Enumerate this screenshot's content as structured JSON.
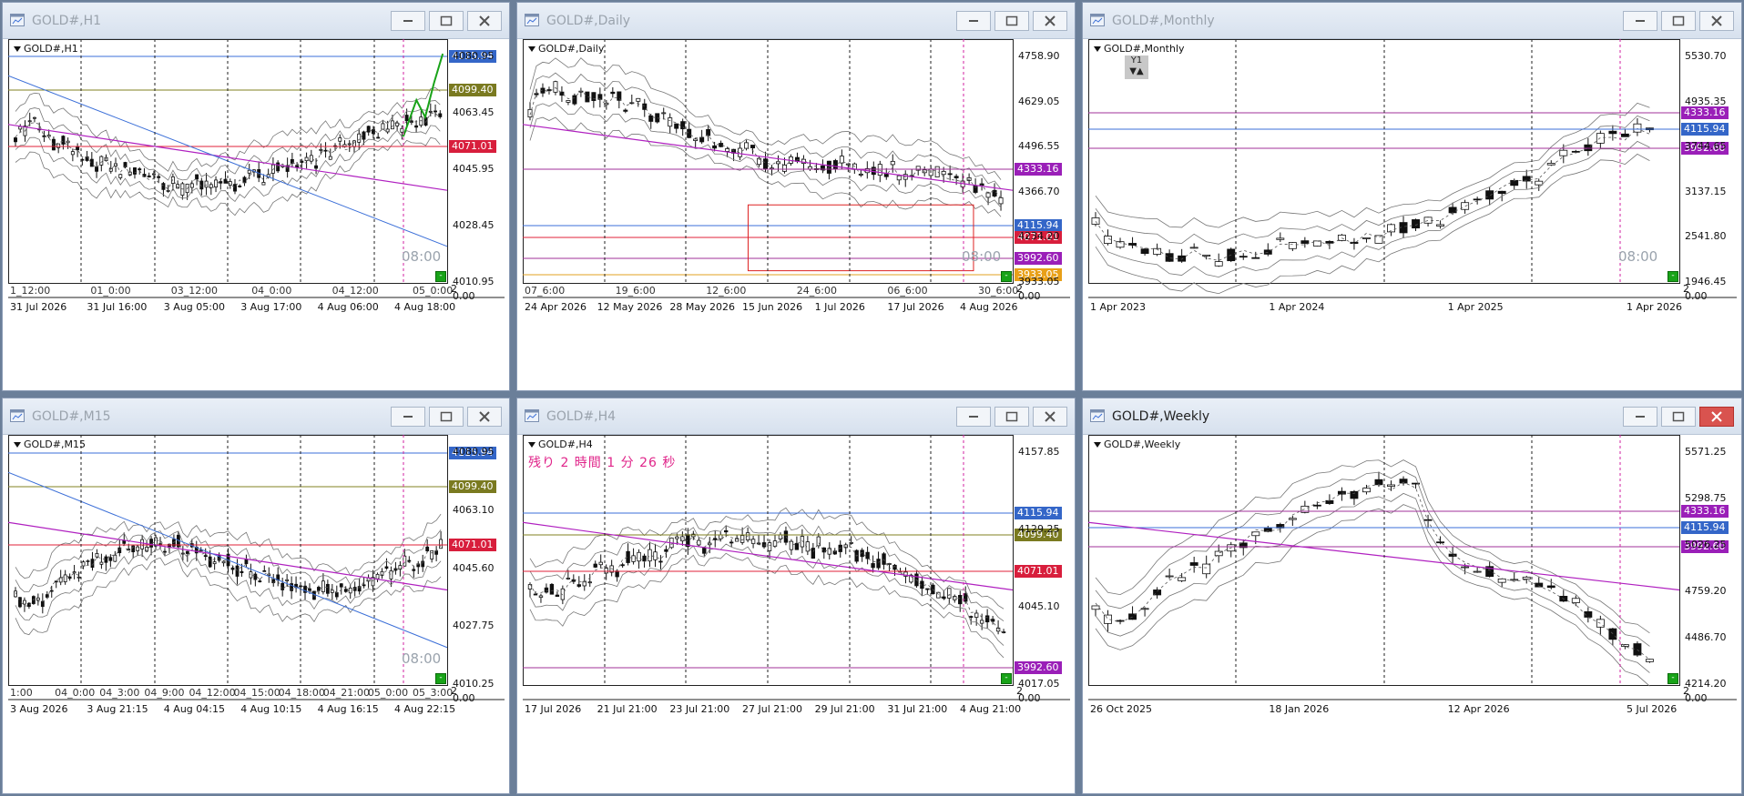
{
  "colors": {
    "blue_line": "#3b6fd8",
    "olive_line": "#808020",
    "red_line": "#e0203a",
    "purple_line": "#a0309a",
    "orange_line": "#e0a020",
    "magenta_trend": "#b020c0",
    "green_arrow": "#19a319",
    "lbl_blue": "#3466c8",
    "lbl_olive": "#7a7a20",
    "lbl_red": "#d81e3c",
    "lbl_purple": "#9a1fb8",
    "lbl_orange": "#e8a018"
  },
  "icons": {
    "window": "chart-window-icon",
    "minimize": "minimize-icon",
    "maximize": "maximize-icon",
    "close": "close-icon",
    "dropdown": "triangle-down-icon"
  },
  "windows": [
    {
      "id": "h1",
      "title": "GOLD#,H1",
      "symbol": "GOLD#,H1",
      "active": false,
      "price_ticks": [
        "4080.95",
        "4063.45",
        "4045.95",
        "4028.45",
        "4010.95"
      ],
      "price_labels": [
        {
          "text": "4115.94",
          "color": "lbl_blue"
        },
        {
          "text": "4099.40",
          "color": "lbl_olive"
        },
        {
          "text": "4071.01",
          "color": "lbl_red"
        }
      ],
      "time_top": [
        "1_12:00",
        "01_0:00",
        "03_12:00",
        "04_0:00",
        "04_12:00",
        "05_0:00"
      ],
      "time_bottom": [
        "31 Jul 2026",
        "31 Jul 16:00",
        "3 Aug 05:00",
        "3 Aug 17:00",
        "4 Aug 06:00",
        "4 Aug 18:00"
      ],
      "vline_label": "08:00",
      "corner_top": "2",
      "corner_bottom": "0.00"
    },
    {
      "id": "daily",
      "title": "GOLD#,Daily",
      "symbol": "GOLD#,Daily",
      "active": false,
      "price_ticks": [
        "4758.90",
        "4629.05",
        "4496.55",
        "4366.70",
        "4234.20",
        "3933.05"
      ],
      "price_labels": [
        {
          "text": "4333.16",
          "color": "lbl_purple"
        },
        {
          "text": "4115.94",
          "color": "lbl_blue"
        },
        {
          "text": "4071.01",
          "color": "lbl_red"
        },
        {
          "text": "3992.60",
          "color": "lbl_purple"
        },
        {
          "text": "3933.05",
          "color": "lbl_orange"
        }
      ],
      "time_top": [
        "07_6:00",
        "19_6:00",
        "12_6:00",
        "24_6:00",
        "06_6:00",
        "30_6:00"
      ],
      "time_bottom": [
        "24 Apr 2026",
        "12 May 2026",
        "28 May 2026",
        "15 Jun 2026",
        "1 Jul 2026",
        "17 Jul 2026",
        "4 Aug 2026"
      ],
      "vline_label": "08:00",
      "corner_top": "2",
      "corner_bottom": "0.00"
    },
    {
      "id": "monthly",
      "title": "GOLD#,Monthly",
      "symbol": "GOLD#,Monthly",
      "active": false,
      "price_ticks": [
        "5530.70",
        "4935.35",
        "3744.65",
        "3137.15",
        "2541.80",
        "1946.45"
      ],
      "price_labels": [
        {
          "text": "4333.16",
          "color": "lbl_purple"
        },
        {
          "text": "4115.94",
          "color": "lbl_blue"
        },
        {
          "text": "3992.60",
          "color": "lbl_purple"
        }
      ],
      "time_bottom": [
        "1 Apr 2023",
        "1 Apr 2024",
        "1 Apr 2025",
        "1 Apr 2026"
      ],
      "vline_label": "08:00",
      "y1_label": "Y1",
      "corner_top": "2",
      "corner_bottom": "0.00"
    },
    {
      "id": "m15",
      "title": "GOLD#,M15",
      "symbol": "GOLD#,M15",
      "active": false,
      "price_ticks": [
        "4080.95",
        "4063.10",
        "4045.60",
        "4027.75",
        "4010.25"
      ],
      "price_labels": [
        {
          "text": "4115.94",
          "color": "lbl_blue"
        },
        {
          "text": "4099.40",
          "color": "lbl_olive"
        },
        {
          "text": "4071.01",
          "color": "lbl_red"
        }
      ],
      "time_top": [
        "1:00",
        "04_0:00",
        "04_3:00",
        "04_9:00",
        "04_12:00",
        "04_15:00",
        "04_18:00",
        "04_21:00",
        "05_0:00",
        "05_3:00"
      ],
      "time_bottom": [
        "3 Aug 2026",
        "3 Aug 21:15",
        "4 Aug 04:15",
        "4 Aug 10:15",
        "4 Aug 16:15",
        "4 Aug 22:15"
      ],
      "vline_label": "08:00",
      "corner_top": "2",
      "corner_bottom": "0.00"
    },
    {
      "id": "h4",
      "title": "GOLD#,H4",
      "symbol": "GOLD#,H4",
      "active": false,
      "countdown": "残り 2 時間 1 分 26 秒",
      "price_ticks": [
        "4157.85",
        "4129.25",
        "4045.10",
        "4017.05"
      ],
      "price_labels": [
        {
          "text": "4115.94",
          "color": "lbl_blue"
        },
        {
          "text": "4099.40",
          "color": "lbl_olive"
        },
        {
          "text": "4071.01",
          "color": "lbl_red"
        },
        {
          "text": "3992.60",
          "color": "lbl_purple"
        }
      ],
      "time_bottom": [
        "17 Jul 2026",
        "21 Jul 21:00",
        "23 Jul 21:00",
        "27 Jul 21:00",
        "29 Jul 21:00",
        "31 Jul 21:00",
        "4 Aug 21:00"
      ],
      "corner_top": "2",
      "corner_bottom": "0.00"
    },
    {
      "id": "weekly",
      "title": "GOLD#,Weekly",
      "symbol": "GOLD#,Weekly",
      "active": true,
      "price_ticks": [
        "5571.25",
        "5298.75",
        "5026.25",
        "4759.20",
        "4486.70",
        "4214.20"
      ],
      "price_labels": [
        {
          "text": "4333.16",
          "color": "lbl_purple"
        },
        {
          "text": "4115.94",
          "color": "lbl_blue"
        },
        {
          "text": "3992.60",
          "color": "lbl_purple"
        }
      ],
      "time_bottom": [
        "26 Oct 2025",
        "18 Jan 2026",
        "12 Apr 2026",
        "5 Jul 2026"
      ],
      "corner_top": "2",
      "corner_bottom": "0.00"
    }
  ]
}
